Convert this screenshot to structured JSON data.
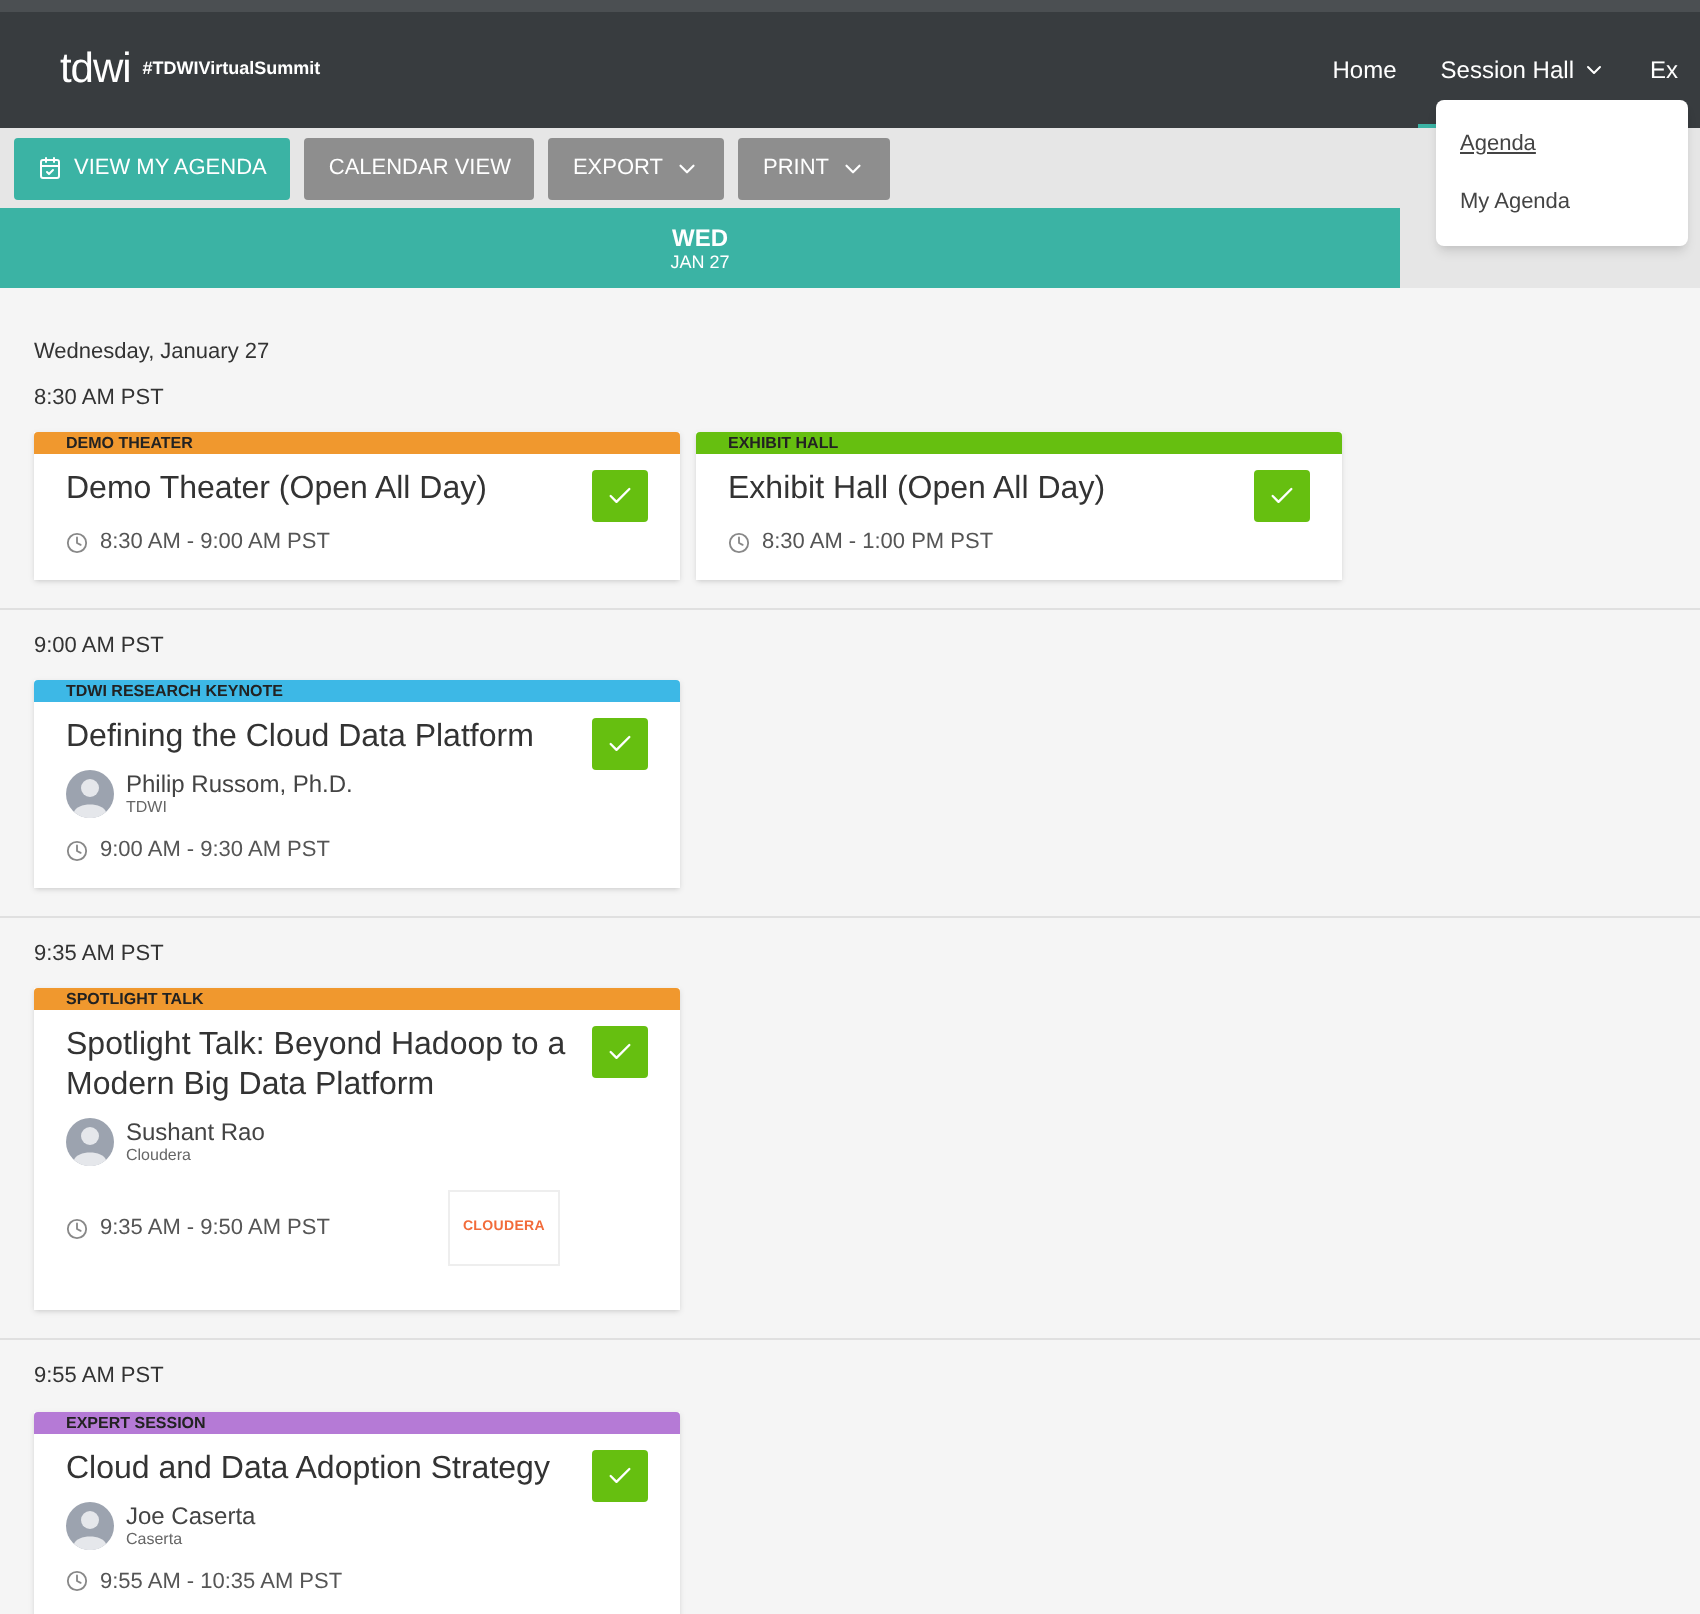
{
  "header": {
    "logo": "tdwi",
    "hashtag": "#TDWIVirtualSummit",
    "nav": [
      {
        "label": "Home",
        "selected": false,
        "has_menu": false
      },
      {
        "label": "Session Hall",
        "selected": true,
        "has_menu": true
      },
      {
        "label": "Ex",
        "selected": false,
        "has_menu": false
      }
    ],
    "menu": [
      {
        "label": "Agenda",
        "selected": true
      },
      {
        "label": "My Agenda",
        "selected": false
      }
    ]
  },
  "toolbar": [
    {
      "label": "VIEW MY AGENDA",
      "kind": "primary"
    },
    {
      "label": "CALENDAR VIEW",
      "kind": "plain"
    },
    {
      "label": "EXPORT",
      "kind": "dropdown"
    },
    {
      "label": "PRINT",
      "kind": "dropdown"
    }
  ],
  "days": [
    {
      "weekday": "WED",
      "date": "JAN 27",
      "selected": true
    }
  ],
  "date_heading": "Wednesday, January 27",
  "slots": [
    {
      "time": "8:30 AM PST",
      "sessions": [
        {
          "category": "DEMO THEATER",
          "color": "#f0982e",
          "title": "Demo Theater (Open All Day)",
          "time": "8:30 AM - 9:00 AM PST",
          "added": true
        },
        {
          "category": "EXHIBIT HALL",
          "color": "#66bf10",
          "title": "Exhibit Hall (Open All Day)",
          "time": "8:30 AM - 1:00 PM PST",
          "added": true
        }
      ]
    },
    {
      "time": "9:00 AM PST",
      "sessions": [
        {
          "category": "TDWI RESEARCH KEYNOTE",
          "color": "#3db8e6",
          "title": "Defining the Cloud Data Platform",
          "speaker": {
            "name": "Philip Russom, Ph.D.",
            "company": "TDWI"
          },
          "time": "9:00 AM - 9:30 AM PST",
          "added": true
        }
      ]
    },
    {
      "time": "9:35 AM PST",
      "sessions": [
        {
          "category": "SPOTLIGHT TALK",
          "color": "#f0982e",
          "title": "Spotlight Talk: Beyond Hadoop to a Modern Big Data Platform",
          "speaker": {
            "name": "Sushant Rao",
            "company": "Cloudera"
          },
          "time": "9:35 AM - 9:50 AM PST",
          "sponsor_logo": "CLOUDERA",
          "added": true
        }
      ]
    },
    {
      "time": "9:55 AM PST",
      "sessions": [
        {
          "category": "EXPERT SESSION",
          "color": "#b57ad6",
          "title": "Cloud and Data Adoption Strategy",
          "speaker": {
            "name": "Joe Caserta",
            "company": "Caserta"
          },
          "time": "9:55 AM - 10:35 AM PST",
          "added": true
        }
      ]
    }
  ]
}
